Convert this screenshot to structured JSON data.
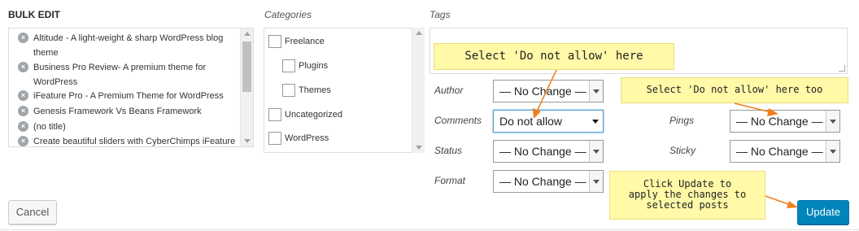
{
  "bulk_edit": {
    "title": "BULK EDIT",
    "posts": [
      "Altitude - A light-weight & sharp WordPress blog theme",
      "Business Pro Review- A premium theme for WordPress",
      "iFeature Pro - A Premium Theme for WordPress",
      "Genesis Framework Vs Beans Framework",
      "(no title)",
      "Create beautiful sliders with CyberChimps iFeature"
    ],
    "remove_icon": "×"
  },
  "categories": {
    "title": "Categories",
    "items": [
      "Freelance",
      "Plugins",
      "Themes",
      "Uncategorized",
      "WordPress"
    ]
  },
  "tags": {
    "title": "Tags",
    "value": ""
  },
  "fields": {
    "author": {
      "label": "Author",
      "value": "— No Change —"
    },
    "comments": {
      "label": "Comments",
      "value": "Do not allow"
    },
    "status": {
      "label": "Status",
      "value": "— No Change —"
    },
    "format": {
      "label": "Format",
      "value": "— No Change —"
    },
    "pings": {
      "label": "Pings",
      "value": "— No Change —"
    },
    "sticky": {
      "label": "Sticky",
      "value": "— No Change —"
    }
  },
  "callouts": {
    "comments_hint": "Select 'Do not allow' here",
    "pings_hint": "Select 'Do not allow' here too",
    "update_hint": [
      "Click Update to",
      "apply the changes to",
      "selected posts"
    ]
  },
  "buttons": {
    "cancel": "Cancel",
    "update": "Update"
  },
  "colors": {
    "primary_button": "#0085ba",
    "callout_bg": "#fff9a8",
    "arrow": "#f07f1a",
    "focus_border": "#5b9dd9"
  }
}
